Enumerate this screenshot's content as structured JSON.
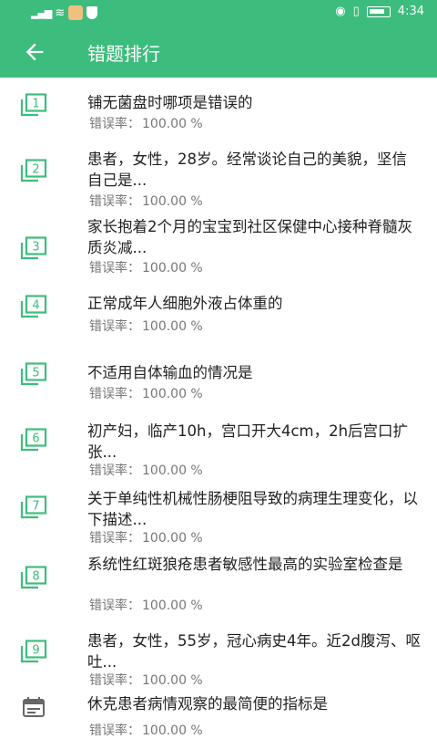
{
  "status": {
    "time": "4:34",
    "signal": "4G"
  },
  "header": {
    "title": "错题排行"
  },
  "rate_label": "错误率：",
  "items": [
    {
      "num": "1",
      "question": "铺无菌盘时哪项是错误的",
      "rate": "100.00 %"
    },
    {
      "num": "2",
      "question": "患者，女性，28岁。经常谈论自己的美貌，坚信自己是...",
      "rate": "100.00 %"
    },
    {
      "num": "3",
      "question": "家长抱着2个月的宝宝到社区保健中心接种脊髓灰质炎减...",
      "rate": "100.00 %"
    },
    {
      "num": "4",
      "question": "正常成年人细胞外液占体重的",
      "rate": "100.00 %"
    },
    {
      "num": "5",
      "question": "不适用自体输血的情况是",
      "rate": "100.00 %"
    },
    {
      "num": "6",
      "question": "初产妇，临产10h，宫口开大4cm，2h后宫口扩张...",
      "rate": "100.00 %"
    },
    {
      "num": "7",
      "question": "关于单纯性机械性肠梗阻导致的病理生理变化，以下描述...",
      "rate": "100.00 %"
    },
    {
      "num": "8",
      "question": "系统性红斑狼疮患者敏感性最高的实验室检查是",
      "rate": "100.00 %"
    },
    {
      "num": "9",
      "question": "患者，女性，55岁，冠心病史4年。近2d腹泻、呕吐...",
      "rate": "100.00 %"
    },
    {
      "num": "",
      "question": "休克患者病情观察的最简便的指标是",
      "rate": "100.00 %"
    }
  ],
  "colors": {
    "accent": "#3dbd7d",
    "text": "#222222",
    "muted": "#777777"
  }
}
